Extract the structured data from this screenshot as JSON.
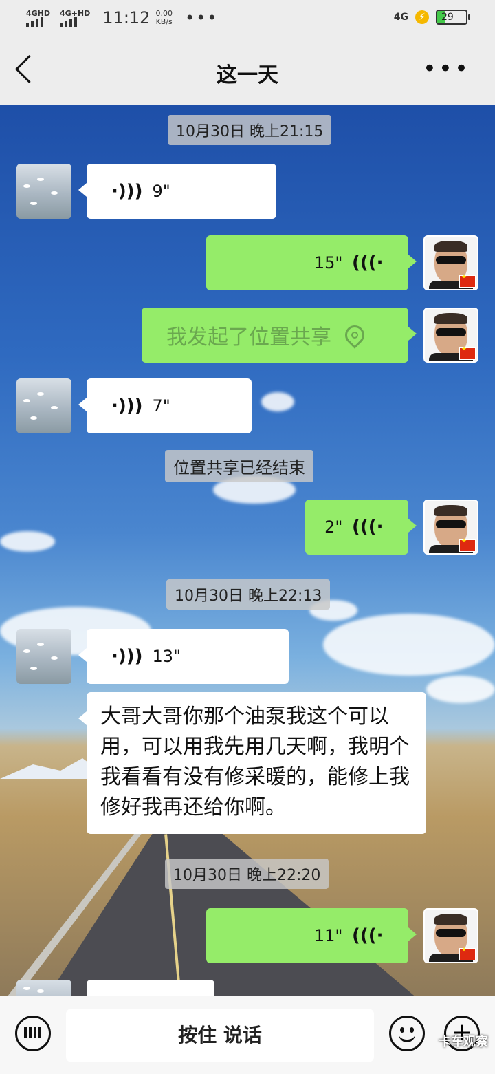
{
  "status_bar": {
    "sim1": "4GHD",
    "sim2": "4G+HD",
    "time": "11:12",
    "speed_value": "0.00",
    "speed_unit": "KB/s",
    "network": "4G",
    "battery": "29"
  },
  "header": {
    "title": "这一天"
  },
  "messages": {
    "ts1": "10月30日 晚上21:15",
    "m1_duration": "9\"",
    "m2_duration": "15\"",
    "m3_text": "我发起了位置共享",
    "m4_duration": "7\"",
    "sys1": "位置共享已经结束",
    "m5_duration": "2\"",
    "ts2": "10月30日 晚上22:13",
    "m6_duration": "13\"",
    "m7_text": "大哥大哥你那个油泵我这个可以用，可以用我先用几天啊，我明个我看看有没有修采暖的，能修上我修好我再还给你啊。",
    "ts3": "10月30日 晚上22:20",
    "m8_duration": "11\""
  },
  "input_bar": {
    "hold_to_talk": "按住 说话"
  },
  "watermark": "卡车观察"
}
